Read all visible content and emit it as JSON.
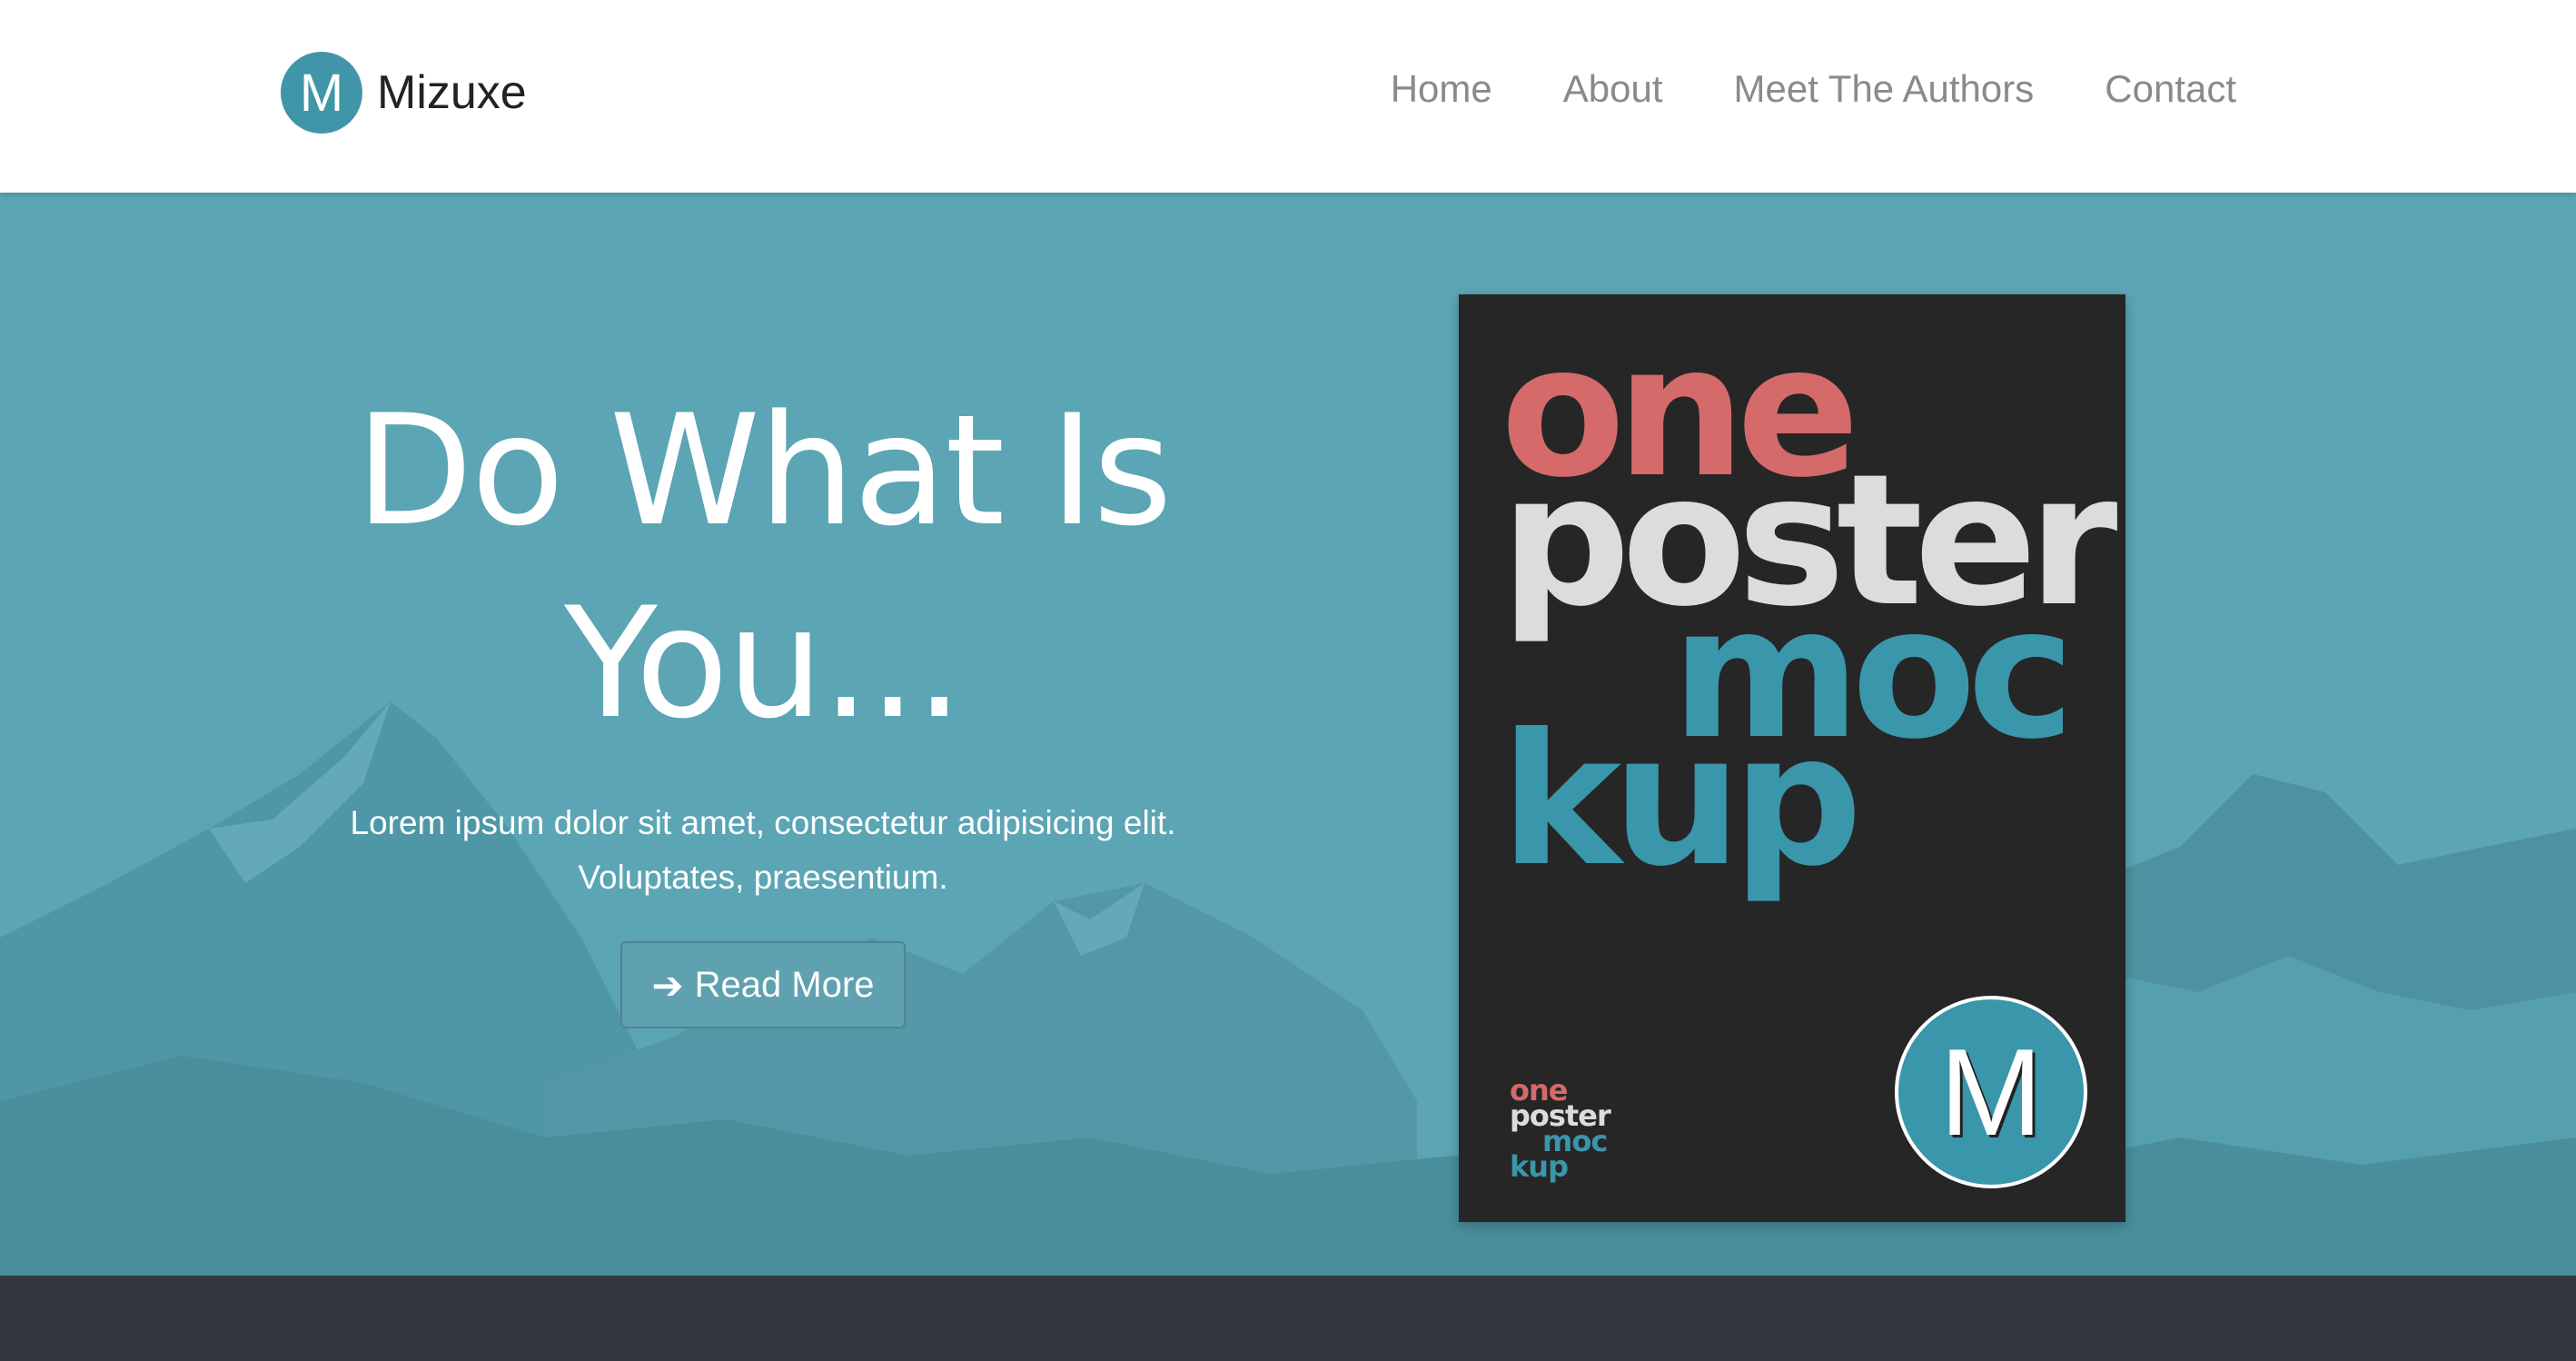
{
  "brand": {
    "logo_letter": "M",
    "name": "Mizuxe"
  },
  "nav": {
    "items": [
      {
        "label": "Home"
      },
      {
        "label": "About"
      },
      {
        "label": "Meet The Authors"
      },
      {
        "label": "Contact"
      }
    ]
  },
  "hero": {
    "title_line1": "Do What Is",
    "title_line2": "You...",
    "subtitle_line1": "Lorem ipsum dolor sit amet, consectetur adipisicing elit.",
    "subtitle_line2": "Voluptates, praesentium.",
    "button_icon": "arrow-right-icon",
    "button_label": "Read More"
  },
  "poster": {
    "word1": "one",
    "word2": "poster",
    "word3": "moc",
    "word4": "kup",
    "logo_letter": "M"
  },
  "colors": {
    "accent": "#4096a8",
    "hero_bg": "#5ba5b4",
    "poster_bg": "#262626",
    "poster_red": "#d46a6a",
    "poster_teal": "#3a96aa",
    "footer_bg": "#343740"
  }
}
